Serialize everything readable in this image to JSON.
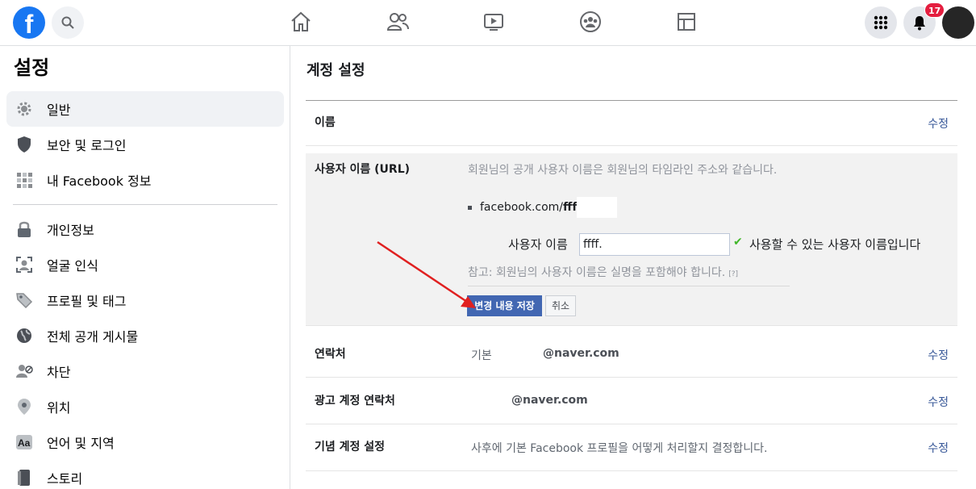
{
  "topbar": {
    "notification_count": "17"
  },
  "sidebar": {
    "title": "설정",
    "items": [
      {
        "label": "일반",
        "icon": "gear-icon"
      },
      {
        "label": "보안 및 로그인",
        "icon": "shield-icon"
      },
      {
        "label": "내 Facebook 정보",
        "icon": "grid-icon"
      },
      {
        "label": "개인정보",
        "icon": "lock-icon"
      },
      {
        "label": "얼굴 인식",
        "icon": "face-scan-icon"
      },
      {
        "label": "프로필 및 태그",
        "icon": "tag-icon"
      },
      {
        "label": "전체 공개 게시물",
        "icon": "globe-icon"
      },
      {
        "label": "차단",
        "icon": "block-user-icon"
      },
      {
        "label": "위치",
        "icon": "location-pin-icon"
      },
      {
        "label": "언어 및 지역",
        "icon": "language-icon"
      },
      {
        "label": "스토리",
        "icon": "book-icon"
      }
    ]
  },
  "main": {
    "title": "계정 설정",
    "edit_label": "수정",
    "name_row": {
      "label": "이름"
    },
    "username_row": {
      "label": "사용자 이름 (URL)",
      "description": "회원님의 공개 사용자 이름은 회원님의 타임라인 주소와 같습니다.",
      "url_prefix": "facebook.com/",
      "url_user": "ffff",
      "field_label": "사용자 이름",
      "field_value": "ffff.",
      "available_msg": "사용할 수 있는 사용자 이름입니다",
      "note": "참고: 회원님의 사용자 이름은 실명을 포함해야 합니다.",
      "help": "[?]",
      "save_label": "변경 내용 저장",
      "cancel_label": "취소"
    },
    "contact_row": {
      "label": "연락처",
      "type": "기본",
      "value": "@naver.com"
    },
    "ad_contact_row": {
      "label": "광고 계정 연락처",
      "value": "@naver.com"
    },
    "memorial_row": {
      "label": "기념 계정 설정",
      "value": "사후에 기본 Facebook 프로필을 어떻게 처리할지 결정합니다."
    }
  },
  "colors": {
    "accent": "#1877f2",
    "link": "#385898",
    "save_button": "#4267b2",
    "arrow": "#e02020"
  }
}
